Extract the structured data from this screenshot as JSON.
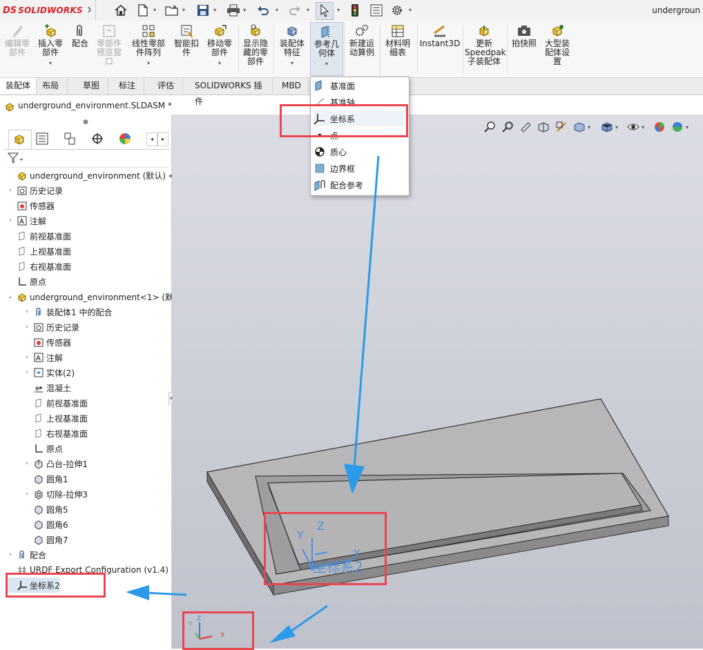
{
  "app": {
    "logo_ds": "DS",
    "logo_name": "SOLIDWORKS",
    "title": "undergroun"
  },
  "ribbon": {
    "edit_part": "编辑零部件",
    "insert_part": "插入零部件",
    "mate": "配合",
    "part_preview": "零部件预览窗口",
    "linear_pattern": "线性零部件阵列",
    "smart_fastener": "智能扣件",
    "move_part": "移动零部件",
    "show_hidden": "显示隐藏的零部件",
    "assembly_feature": "装配体特征",
    "ref_geometry": "参考几何体",
    "new_motion": "新建运动算例",
    "bom": "材料明细表",
    "instant3d": "Instant3D",
    "speedpak": "更新Speedpak子装配体",
    "snapshot": "拍快照",
    "large_assembly": "大型装配体设置"
  },
  "tabs": [
    "装配体",
    "布局",
    "草图",
    "标注",
    "评估",
    "SOLIDWORKS 插件",
    "MBD"
  ],
  "document": {
    "title": "underground_environment.SLDASM *"
  },
  "ref_geometry_menu": {
    "items": [
      "基准面",
      "基准轴",
      "坐标系",
      "点",
      "质心",
      "边界框",
      "配合参考"
    ],
    "highlighted": "坐标系"
  },
  "tree": [
    {
      "label": "underground_environment (默认) <默",
      "icon": "assembly-icon"
    },
    {
      "label": "历史记录",
      "icon": "history-icon"
    },
    {
      "label": "传感器",
      "icon": "sensor-icon"
    },
    {
      "label": "注解",
      "icon": "annotation-icon"
    },
    {
      "label": "前视基准面",
      "icon": "plane-icon"
    },
    {
      "label": "上视基准面",
      "icon": "plane-icon"
    },
    {
      "label": "右视基准面",
      "icon": "plane-icon"
    },
    {
      "label": "原点",
      "icon": "origin-icon"
    },
    {
      "label": "underground_environment<1> (默",
      "icon": "part-icon"
    },
    {
      "label": "装配体1 中的配合",
      "icon": "mates-icon"
    },
    {
      "label": "历史记录",
      "icon": "history-icon"
    },
    {
      "label": "传感器",
      "icon": "sensor-icon"
    },
    {
      "label": "注解",
      "icon": "annotation-icon"
    },
    {
      "label": "实体(2)",
      "icon": "solid-bodies-icon"
    },
    {
      "label": "混凝土",
      "icon": "material-icon"
    },
    {
      "label": "前视基准面",
      "icon": "plane-icon"
    },
    {
      "label": "上视基准面",
      "icon": "plane-icon"
    },
    {
      "label": "右视基准面",
      "icon": "plane-icon"
    },
    {
      "label": "原点",
      "icon": "origin-icon"
    },
    {
      "label": "凸台-拉伸1",
      "icon": "boss-extrude-icon"
    },
    {
      "label": "圆角1",
      "icon": "fillet-icon"
    },
    {
      "label": "切除-拉伸3",
      "icon": "cut-extrude-icon"
    },
    {
      "label": "圆角5",
      "icon": "fillet-icon"
    },
    {
      "label": "圆角6",
      "icon": "fillet-icon"
    },
    {
      "label": "圆角7",
      "icon": "fillet-icon"
    },
    {
      "label": "配合",
      "icon": "mates-icon"
    },
    {
      "label": "URDF Export Configuration (v1.4)",
      "icon": "urdf-icon"
    },
    {
      "label": "坐标系2",
      "icon": "coordinate-system-icon"
    }
  ],
  "viewport": {
    "csys_label": "坐标系2",
    "axis_x": "X",
    "axis_y": "Y",
    "axis_z": "Z",
    "triad_x": "X",
    "triad_y": "Y",
    "triad_z": "Z"
  },
  "colors": {
    "highlight_box": "#e8454c",
    "annotation_arrow": "#2b9ae8",
    "csys_blue": "#4b8fe0"
  }
}
